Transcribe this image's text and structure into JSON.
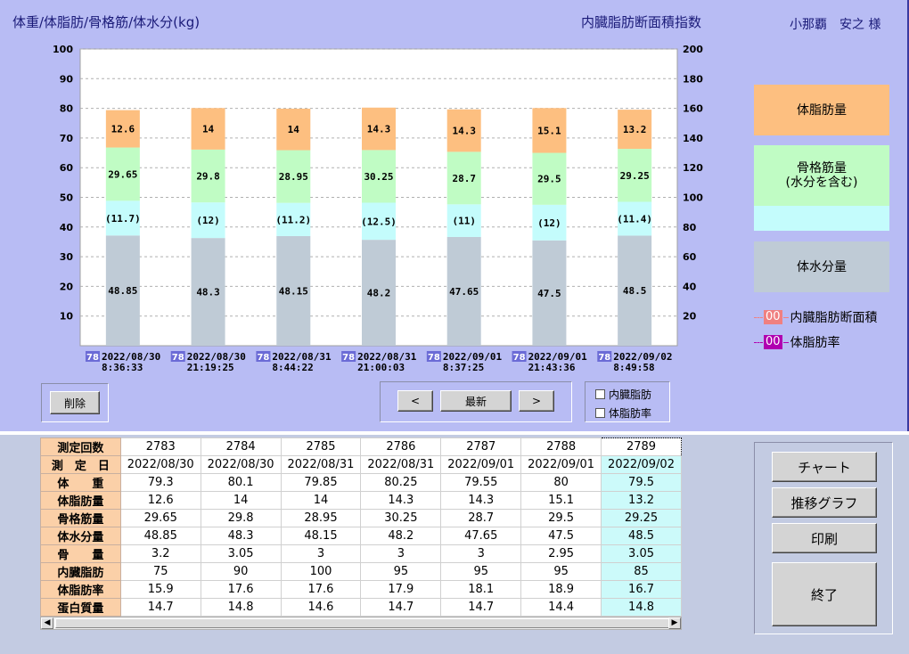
{
  "header": {
    "title_left": "体重/体脂肪/骨格筋/体水分(kg)",
    "title_right": "内臓脂肪断面積指数",
    "patient": "小那覇　安之 様"
  },
  "chart_data": {
    "type": "bar",
    "stacked": true,
    "y_left": {
      "ticks": [
        10,
        20,
        30,
        40,
        50,
        60,
        70,
        80,
        90,
        100
      ],
      "range": [
        0,
        100
      ]
    },
    "y_right": {
      "ticks": [
        20,
        40,
        60,
        80,
        100,
        120,
        140,
        160,
        180,
        200
      ],
      "range": [
        0,
        200
      ]
    },
    "grid": true,
    "colors": {
      "fat": "#fdbf80",
      "muscle": "#c0fcc4",
      "water_extra": "#c4fcfc",
      "water": "#bfcbd6"
    },
    "x_labels": [
      {
        "tag": "78",
        "date": "2022/08/30",
        "time": "8:36:33"
      },
      {
        "tag": "78",
        "date": "2022/08/30",
        "time": "21:19:25"
      },
      {
        "tag": "78",
        "date": "2022/08/31",
        "time": "8:44:22"
      },
      {
        "tag": "78",
        "date": "2022/08/31",
        "time": "21:00:03"
      },
      {
        "tag": "78",
        "date": "2022/09/01",
        "time": "8:37:25"
      },
      {
        "tag": "78",
        "date": "2022/09/01",
        "time": "21:43:36"
      },
      {
        "tag": "78",
        "date": "2022/09/02",
        "time": "8:49:58"
      }
    ],
    "bars": [
      {
        "water": 37.15,
        "water_label": "48.85",
        "extra": 11.7,
        "extra_label": "(11.7)",
        "muscle": 17.95,
        "muscle_label": "29.65",
        "fat": 12.6,
        "fat_label": "12.6"
      },
      {
        "water": 36.3,
        "water_label": "48.3",
        "extra": 12,
        "extra_label": "(12)",
        "muscle": 17.8,
        "muscle_label": "29.8",
        "fat": 14,
        "fat_label": "14"
      },
      {
        "water": 36.95,
        "water_label": "48.15",
        "extra": 11.2,
        "extra_label": "(11.2)",
        "muscle": 17.75,
        "muscle_label": "28.95",
        "fat": 14,
        "fat_label": "14"
      },
      {
        "water": 35.7,
        "water_label": "48.2",
        "extra": 12.5,
        "extra_label": "(12.5)",
        "muscle": 17.75,
        "muscle_label": "30.25",
        "fat": 14.3,
        "fat_label": "14.3"
      },
      {
        "water": 36.65,
        "water_label": "47.65",
        "extra": 11,
        "extra_label": "(11)",
        "muscle": 17.7,
        "muscle_label": "28.7",
        "fat": 14.3,
        "fat_label": "14.3"
      },
      {
        "water": 35.5,
        "water_label": "47.5",
        "extra": 12,
        "extra_label": "(12)",
        "muscle": 17.5,
        "muscle_label": "29.5",
        "fat": 15.1,
        "fat_label": "15.1"
      },
      {
        "water": 37.1,
        "water_label": "48.5",
        "extra": 11.4,
        "extra_label": "(11.4)",
        "muscle": 17.85,
        "muscle_label": "29.25",
        "fat": 13.2,
        "fat_label": "13.2"
      }
    ]
  },
  "legend": {
    "fat": "体脂肪量",
    "muscle": "骨格筋量\n(水分を含む)",
    "water": "体水分量",
    "visceral_badge": "00",
    "visceral_label": "内臓脂肪断面積",
    "visceral_color": "#f08080",
    "bodyfat_badge": "00",
    "bodyfat_label": "体脂肪率",
    "bodyfat_color": "#b000b0"
  },
  "controls": {
    "delete": "削除",
    "prev": "<",
    "latest": "最新",
    "next": ">",
    "chk_visceral": "内臓脂肪",
    "chk_bodyfat": "体脂肪率"
  },
  "table": {
    "rows": [
      {
        "label": "測定回数",
        "values": [
          "2783",
          "2784",
          "2785",
          "2786",
          "2787",
          "2788",
          "2789"
        ]
      },
      {
        "label": "測　定　日",
        "values": [
          "2022/08/30",
          "2022/08/30",
          "2022/08/31",
          "2022/08/31",
          "2022/09/01",
          "2022/09/01",
          "2022/09/02"
        ]
      },
      {
        "label": "体　　重",
        "values": [
          "79.3",
          "80.1",
          "79.85",
          "80.25",
          "79.55",
          "80",
          "79.5"
        ]
      },
      {
        "label": "体脂肪量",
        "values": [
          "12.6",
          "14",
          "14",
          "14.3",
          "14.3",
          "15.1",
          "13.2"
        ]
      },
      {
        "label": "骨格筋量",
        "values": [
          "29.65",
          "29.8",
          "28.95",
          "30.25",
          "28.7",
          "29.5",
          "29.25"
        ]
      },
      {
        "label": "体水分量",
        "values": [
          "48.85",
          "48.3",
          "48.15",
          "48.2",
          "47.65",
          "47.5",
          "48.5"
        ]
      },
      {
        "label": "骨　　量",
        "values": [
          "3.2",
          "3.05",
          "3",
          "3",
          "3",
          "2.95",
          "3.05"
        ]
      },
      {
        "label": "内臓脂肪",
        "values": [
          "75",
          "90",
          "100",
          "95",
          "95",
          "95",
          "85"
        ]
      },
      {
        "label": "体脂肪率",
        "values": [
          "15.9",
          "17.6",
          "17.6",
          "17.9",
          "18.1",
          "18.9",
          "16.7"
        ]
      },
      {
        "label": "蛋白質量",
        "values": [
          "14.7",
          "14.8",
          "14.6",
          "14.7",
          "14.7",
          "14.4",
          "14.8"
        ]
      }
    ]
  },
  "side_buttons": {
    "chart": "チャート",
    "trend": "推移グラフ",
    "print": "印刷",
    "exit": "終了"
  }
}
